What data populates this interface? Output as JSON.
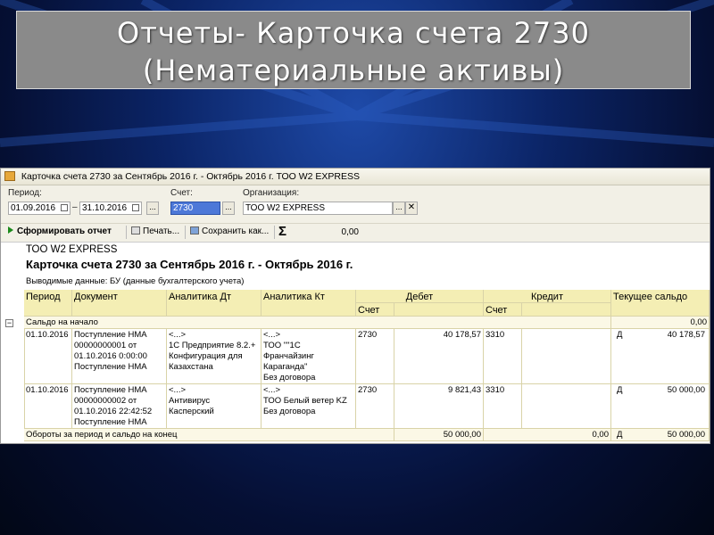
{
  "slide": {
    "title_line1": "Отчеты- Карточка счета 2730",
    "title_line2": "(Нематериальные активы)"
  },
  "window": {
    "title": "Карточка счета 2730 за Сентябрь 2016 г. - Октябрь 2016 г. ТОО W2 EXPRESS"
  },
  "params": {
    "period_label": "Период:",
    "date_from": "01.09.2016",
    "dash": "–",
    "date_to": "31.10.2016",
    "dots": "...",
    "account_label": "Счет:",
    "account_value": "2730",
    "org_label": "Организация:",
    "org_value": "ТОО W2 EXPRESS",
    "clear": "✕"
  },
  "toolbar": {
    "generate_label": "Сформировать отчет",
    "print_label": "Печать...",
    "save_label": "Сохранить как...",
    "sigma": "Σ",
    "sum_value": "0,00"
  },
  "report": {
    "org": "ТОО W2 EXPRESS",
    "heading": "Карточка счета 2730 за Сентябрь 2016 г. - Октябрь 2016 г.",
    "data_line": "Выводимые данные:  БУ (данные бухгалтерского учета)",
    "columns": {
      "period": "Период",
      "document": "Документ",
      "an_dt": "Аналитика Дт",
      "an_kt": "Аналитика Кт",
      "debit": "Дебет",
      "credit": "Кредит",
      "balance": "Текущее сальдо",
      "debit_acc": "Счет",
      "credit_acc": "Счет"
    },
    "opening": {
      "label": "Сальдо на начало",
      "value": "0,00"
    },
    "rows": [
      {
        "period": "01.10.2016",
        "document": [
          "Поступление НМА",
          "00000000001 от",
          "01.10.2016 0:00:00",
          "Поступление НМА"
        ],
        "an_dt": [
          "<...>",
          "1С Предприятие 8.2.+",
          "Конфигурация для",
          "Казахстана"
        ],
        "an_kt": [
          "<...>",
          "ТОО \"\"1С",
          "Франчайзинг",
          "Караганда\"",
          "Без договора"
        ],
        "debit_acc": "2730",
        "debit_sum": "40 178,57",
        "credit_acc": "3310",
        "credit_sum": "",
        "bal_dir": "Д",
        "bal_sum": "40 178,57"
      },
      {
        "period": "01.10.2016",
        "document": [
          "Поступление НМА",
          "00000000002 от",
          "01.10.2016 22:42:52",
          "Поступление НМА"
        ],
        "an_dt": [
          "<...>",
          "Антивирус",
          "Касперский"
        ],
        "an_kt": [
          "<...>",
          "ТОО Белый ветер KZ",
          "Без договора"
        ],
        "debit_acc": "2730",
        "debit_sum": "9 821,43",
        "credit_acc": "3310",
        "credit_sum": "",
        "bal_dir": "Д",
        "bal_sum": "50 000,00"
      }
    ],
    "totals": {
      "label": "Обороты за период и сальдо на конец",
      "debit": "50 000,00",
      "credit": "0,00",
      "dir": "Д",
      "balance": "50 000,00"
    }
  }
}
